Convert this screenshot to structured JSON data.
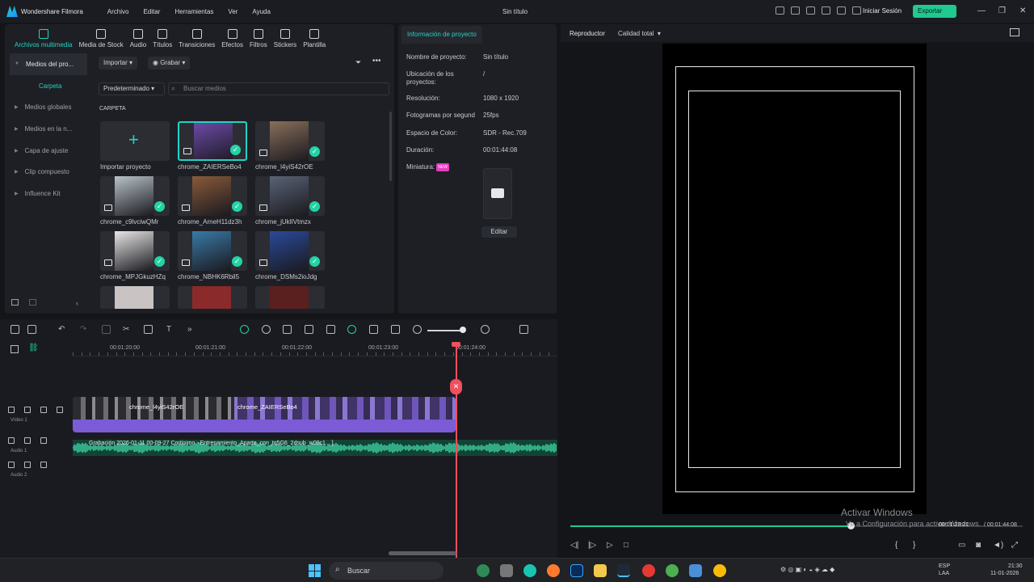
{
  "app": {
    "name": "Wondershare Filmora",
    "menu": [
      "Archivo",
      "Editar",
      "Herramientas",
      "Ver",
      "Ayuda"
    ],
    "title": "Sin título",
    "login": "Iniciar Sesión",
    "export": "Exportar"
  },
  "media": {
    "tabs": [
      "Archivos multimedia",
      "Media de Stock",
      "Audio",
      "Títulos",
      "Transiciones",
      "Efectos",
      "Filtros",
      "Stickers",
      "Plantilla"
    ],
    "sidebar": [
      "Medios del pro...",
      "Carpeta",
      "Medios globales",
      "Medios en la n...",
      "Capa de ajuste",
      "Clip compuesto",
      "Influence Kit"
    ],
    "import_label": "Importar",
    "record_label": "Grabar",
    "sort_label": "Predeterminado",
    "search_placeholder": "Buscar medios",
    "section": "CARPETA",
    "import_project": "Importar proyecto",
    "items": [
      {
        "name": "chrome_ZAIERSeBo4",
        "color": "#6d4aa8"
      },
      {
        "name": "chrome_l4yiS42rOE",
        "color": "#8a6f5a"
      },
      {
        "name": "chrome_c9lvciwQMr",
        "color": "#b9c2c9"
      },
      {
        "name": "chrome_ArneH11dz3h",
        "color": "#8a5a3a"
      },
      {
        "name": "chrome_jUklIVtmzx",
        "color": "#5a6376"
      },
      {
        "name": "chrome_MPJGkuzHZq",
        "color": "#e8e6e6"
      },
      {
        "name": "chrome_NBHK6Rbil5",
        "color": "#3a7aa8"
      },
      {
        "name": "chrome_DSMs2ioJdg",
        "color": "#2a4a9a"
      }
    ]
  },
  "project": {
    "tab": "Información de proyecto",
    "fields": [
      {
        "label": "Nombre de proyecto:",
        "value": "Sin título"
      },
      {
        "label": "Ubicación de los proyectos:",
        "value": "/"
      },
      {
        "label": "Resolución:",
        "value": "1080 x 1920"
      },
      {
        "label": "Fotogramas por segund",
        "value": "25fps"
      },
      {
        "label": "Espacio de Color:",
        "value": "SDR - Rec.709"
      },
      {
        "label": "Duración:",
        "value": "00:01:44:08"
      }
    ],
    "thumbnail_label": "Miniatura:",
    "new_badge": "NEW",
    "edit_label": "Editar"
  },
  "player": {
    "tab": "Reproductor",
    "quality": "Calidad total",
    "current_time": "00:01:23:21",
    "total_time": "00:01:44:08",
    "progress_fraction": 0.62,
    "watermark_title": "Activar Windows",
    "watermark_sub": "Ve a Configuración para activar Windows."
  },
  "timeline": {
    "ruler": [
      "00:01:20:00",
      "00:01:21:00",
      "00:01:22:00",
      "00:01:23:00",
      "00:01:24:00"
    ],
    "tracks": [
      {
        "label": "Vídeo 1",
        "num": "1"
      },
      {
        "label": "Audio 1",
        "num": "1"
      },
      {
        "label": "Audio 2",
        "num": "2"
      }
    ],
    "clip_labels": [
      "chrome_l4yiS42rOE",
      "chrome_ZAIERSeBo4"
    ],
    "audio_label": "Grabación 2026-01-11 00-09-27 Cortísimo - Entrenamiento_Aparte_con_tq5G6_2dsub_w09c1... ]"
  },
  "taskbar": {
    "search": "Buscar",
    "lang1": "ESP",
    "lang2": "LAA",
    "time": "21:30",
    "date": "11-01-2026"
  }
}
